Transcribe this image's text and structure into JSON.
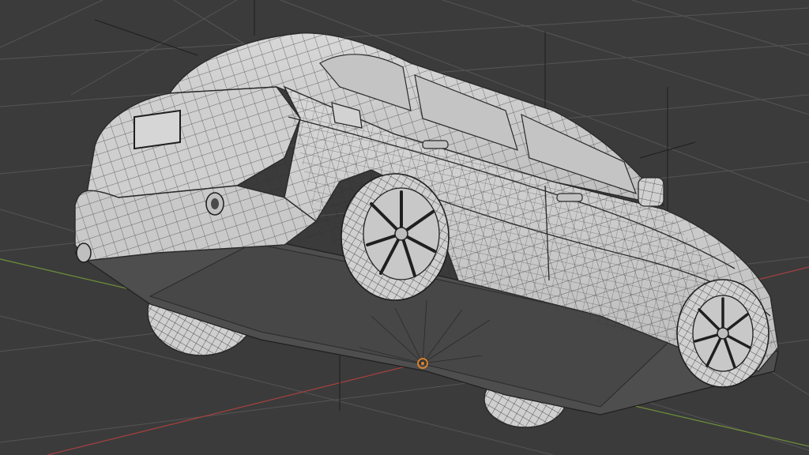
{
  "viewport": {
    "background_color": "#3b3b3b",
    "grid_color": "#545454",
    "x_axis_color": "#a8403f",
    "y_axis_color": "#6f8f3a",
    "mesh_fill_color": "#d2d2d2",
    "mesh_wire_color": "#2a2a2a",
    "underside_color": "#505050",
    "origin_color": "#e0842a"
  },
  "scene": {
    "object": "car-wireframe-mesh",
    "view": "perspective-from-below",
    "shading": "solid-with-wireframe-overlay"
  }
}
